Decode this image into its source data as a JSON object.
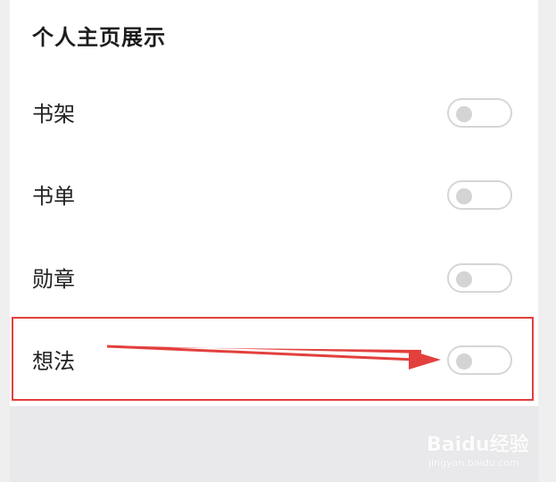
{
  "section": {
    "title": "个人主页展示"
  },
  "rows": [
    {
      "label": "书架",
      "enabled": false
    },
    {
      "label": "书单",
      "enabled": false
    },
    {
      "label": "勋章",
      "enabled": false
    },
    {
      "label": "想法",
      "enabled": false
    }
  ],
  "annotation": {
    "highlight_color": "#e2403d",
    "arrow_color": "#e2403d"
  },
  "watermark": {
    "brand": "Baidu经验",
    "sub": "jingyan.baidu.com"
  },
  "colors": {
    "panel_bg": "#ffffff",
    "outer_bg": "#efeff0",
    "toggle_border": "#d6d6d8",
    "toggle_knob": "#d4d4d6",
    "title_text": "#1c1c1e"
  }
}
